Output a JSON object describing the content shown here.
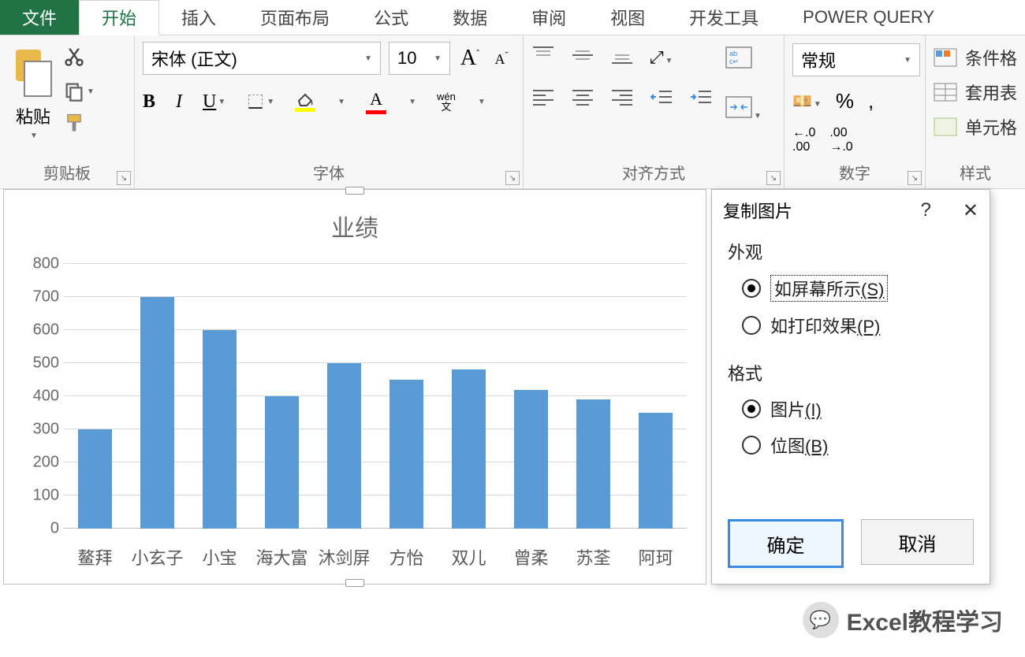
{
  "tabs": {
    "file": "文件",
    "home": "开始",
    "insert": "插入",
    "layout": "页面布局",
    "formula": "公式",
    "data": "数据",
    "review": "审阅",
    "view": "视图",
    "dev": "开发工具",
    "pq": "POWER QUERY"
  },
  "ribbon": {
    "clipboard": {
      "paste": "粘贴",
      "label": "剪贴板"
    },
    "font": {
      "name": "宋体 (正文)",
      "size": "10",
      "label": "字体",
      "wen_top": "wén",
      "wen_bottom": "文"
    },
    "align": {
      "label": "对齐方式"
    },
    "number": {
      "format": "常规",
      "inc": ".00",
      "dec": ".00",
      "label": "数字"
    },
    "styles": {
      "cond": "条件格",
      "table": "套用表",
      "cell": "单元格",
      "label": "样式"
    }
  },
  "chart_data": {
    "type": "bar",
    "title": "业绩",
    "categories": [
      "鳌拜",
      "小玄子",
      "小宝",
      "海大富",
      "沐剑屏",
      "方怡",
      "双儿",
      "曾柔",
      "苏荃",
      "阿珂"
    ],
    "values": [
      300,
      700,
      600,
      400,
      500,
      450,
      480,
      420,
      390,
      350
    ],
    "ylim": [
      0,
      800
    ],
    "ystep": 100,
    "xlabel": "",
    "ylabel": ""
  },
  "dialog": {
    "title": "复制图片",
    "help": "?",
    "close": "✕",
    "appearance_lbl": "外观",
    "appearance_screen": "如屏幕所示",
    "appearance_screen_key": "(S)",
    "appearance_print": "如打印效果",
    "appearance_print_key": "(P)",
    "format_lbl": "格式",
    "format_picture": "图片",
    "format_picture_key": "(I)",
    "format_bitmap": "位图",
    "format_bitmap_key": "(B)",
    "ok": "确定",
    "cancel": "取消"
  },
  "watermark": "Excel教程学习"
}
